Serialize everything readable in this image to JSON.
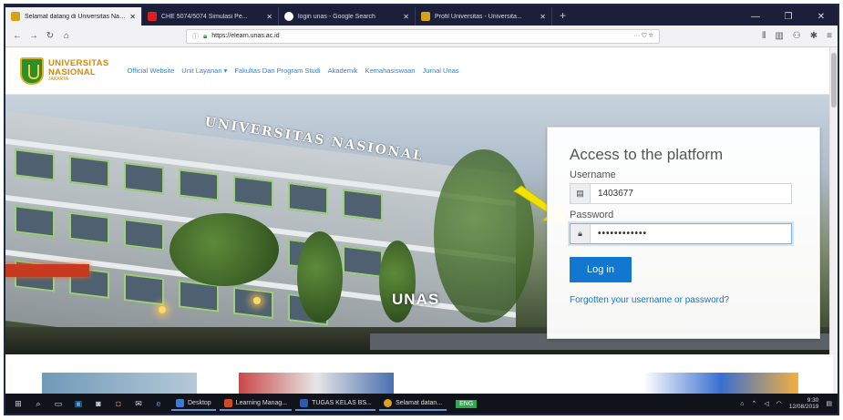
{
  "browser": {
    "tabs": [
      {
        "title": "Selamat datang di Universitas Nasional",
        "icon": "unas-favicon",
        "color": "#d7a21a",
        "active": true
      },
      {
        "title": "CHE 5074/5074 Simulasi Pe...",
        "icon": "youtube-favicon",
        "color": "#e02020",
        "active": false
      },
      {
        "title": "login unas - Google Search",
        "icon": "google-favicon",
        "color": "#ffffff",
        "active": false
      },
      {
        "title": "Profil Universitas - Universita...",
        "icon": "unas-favicon",
        "color": "#d7a21a",
        "active": false
      }
    ],
    "new_tab": "+",
    "window_controls": {
      "minimize": "—",
      "maximize": "❐",
      "close": "✕"
    },
    "url": {
      "prefix": "https://",
      "host": "elearn.unas.ac.id",
      "display": "https://elearn.unas.ac.id"
    },
    "toolbar_right": "··· ⛉ ☆"
  },
  "site": {
    "logo": {
      "line1": "UNIVERSITAS",
      "line2": "NASIONAL",
      "line3": "JAKARTA"
    },
    "menu": [
      "Official Website",
      "Unit Layanan ▾",
      "Fakultas Dan Program Studi",
      "Akademik",
      "Kemahasiswaan",
      "Jurnal Unas"
    ],
    "hero": {
      "building_sign": "UNIVERSITAS NASIONAL",
      "unas_sign": "UNAS"
    }
  },
  "login": {
    "title": "Access to the platform",
    "username_label": "Username",
    "username_value": "1403677",
    "password_label": "Password",
    "password_value": "••••••••••••",
    "login_button": "Log in",
    "forgot_link": "Forgotten your username or password?"
  },
  "taskbar": {
    "apps": [
      {
        "label": "Desktop",
        "color": "#3b7bd6"
      },
      {
        "label": "Learning Manag...",
        "color": "#d04a2a"
      },
      {
        "label": "TUGAS KELAS BS...",
        "color": "#2a5bb0"
      },
      {
        "label": "Selamat datan...",
        "color": "#e0a020"
      }
    ],
    "badge": "ENG",
    "time": "9:30",
    "date": "12/08/2019"
  },
  "colors": {
    "accent": "#1177d1",
    "brand_green": "#2f8d2a",
    "brand_gold": "#d08a10",
    "arrow": "#f2e200"
  }
}
